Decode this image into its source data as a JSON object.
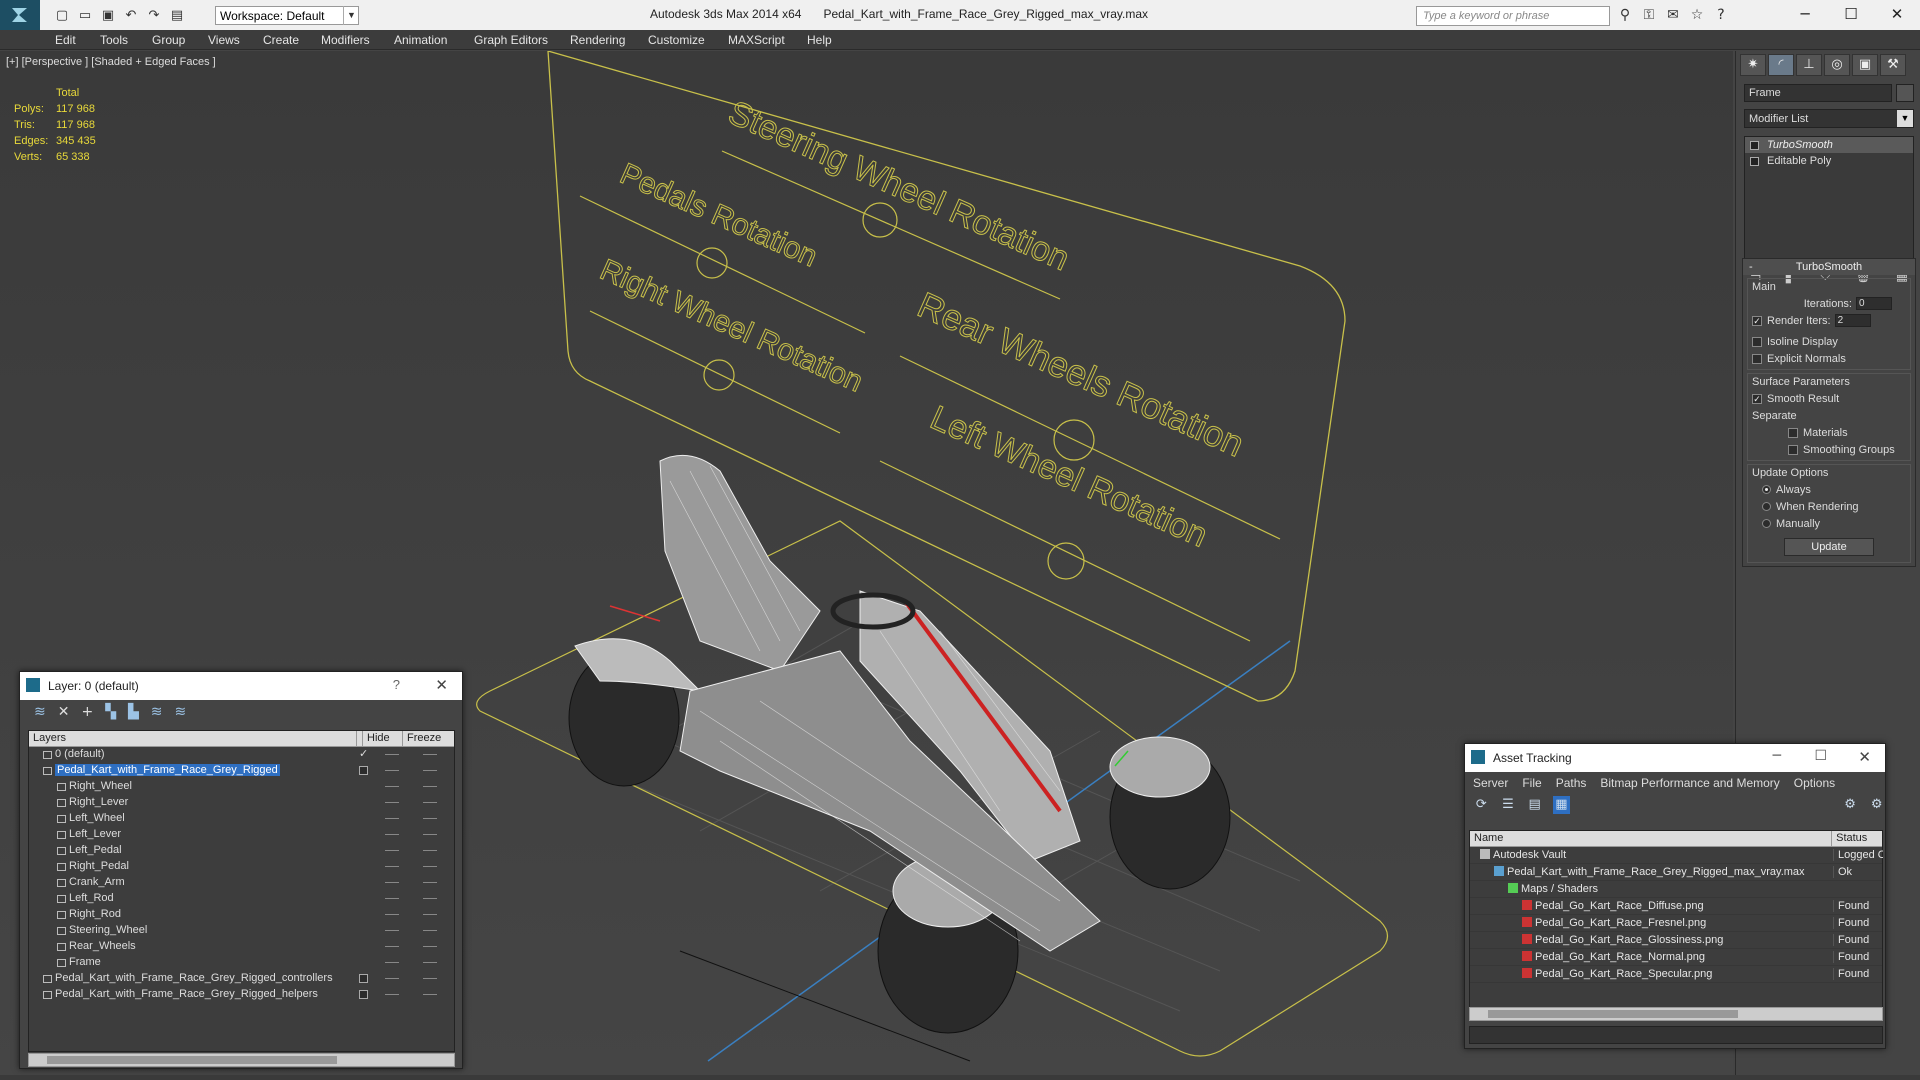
{
  "titlebar": {
    "workspace": "Workspace: Default",
    "app": "Autodesk 3ds Max  2014 x64",
    "file": "Pedal_Kart_with_Frame_Race_Grey_Rigged_max_vray.max",
    "search_placeholder": "Type a keyword or phrase"
  },
  "menu": [
    "Edit",
    "Tools",
    "Group",
    "Views",
    "Create",
    "Modifiers",
    "Animation",
    "Graph Editors",
    "Rendering",
    "Customize",
    "MAXScript",
    "Help"
  ],
  "viewport": {
    "label": "[+] [Perspective ] [Shaded + Edged Faces ]",
    "stats": {
      "header": "Total",
      "rows": [
        {
          "k": "Polys:",
          "v": "117 968"
        },
        {
          "k": "Tris:",
          "v": "117 968"
        },
        {
          "k": "Edges:",
          "v": "345 435"
        },
        {
          "k": "Verts:",
          "v": "65 338"
        }
      ]
    },
    "controls": [
      "Steering Wheel Rotation",
      "Pedals Rotation",
      "Right Wheel Rotation",
      "Rear Wheels Rotation",
      "Left Wheel Rotation"
    ]
  },
  "command_panel": {
    "object_name": "Frame",
    "modifier_list": "Modifier List",
    "stack": [
      "TurboSmooth",
      "Editable Poly"
    ],
    "rollout_title": "TurboSmooth",
    "main": {
      "title": "Main",
      "iterations_label": "Iterations:",
      "iterations_value": "0",
      "render_iters_label": "Render Iters:",
      "render_iters_value": "2",
      "isoline": "Isoline Display",
      "explicit": "Explicit Normals"
    },
    "surface": {
      "title": "Surface Parameters",
      "smooth": "Smooth Result",
      "separate": "Separate",
      "materials": "Materials",
      "smoothing": "Smoothing Groups"
    },
    "update": {
      "title": "Update Options",
      "always": "Always",
      "when": "When Rendering",
      "manually": "Manually",
      "button": "Update"
    }
  },
  "layer_dialog": {
    "title": "Layer: 0 (default)",
    "help": "?",
    "cols": [
      "Layers",
      "Hide",
      "Freeze"
    ],
    "rows": [
      {
        "name": "0 (default)",
        "indent": 0,
        "sel": false,
        "check": true,
        "box": false
      },
      {
        "name": "Pedal_Kart_with_Frame_Race_Grey_Rigged",
        "indent": 0,
        "sel": true,
        "check": false,
        "box": true
      },
      {
        "name": "Right_Wheel",
        "indent": 1
      },
      {
        "name": "Right_Lever",
        "indent": 1
      },
      {
        "name": "Left_Wheel",
        "indent": 1
      },
      {
        "name": "Left_Lever",
        "indent": 1
      },
      {
        "name": "Left_Pedal",
        "indent": 1
      },
      {
        "name": "Right_Pedal",
        "indent": 1
      },
      {
        "name": "Crank_Arm",
        "indent": 1
      },
      {
        "name": "Left_Rod",
        "indent": 1
      },
      {
        "name": "Right_Rod",
        "indent": 1
      },
      {
        "name": "Steering_Wheel",
        "indent": 1
      },
      {
        "name": "Rear_Wheels",
        "indent": 1
      },
      {
        "name": "Frame",
        "indent": 1
      },
      {
        "name": "Pedal_Kart_with_Frame_Race_Grey_Rigged_controllers",
        "indent": 0,
        "box": true
      },
      {
        "name": "Pedal_Kart_with_Frame_Race_Grey_Rigged_helpers",
        "indent": 0,
        "box": true
      }
    ]
  },
  "asset_dialog": {
    "title": "Asset Tracking",
    "menu": [
      "Server",
      "File",
      "Paths",
      "Bitmap Performance and Memory",
      "Options"
    ],
    "cols": [
      "Name",
      "Status"
    ],
    "rows": [
      {
        "name": "Autodesk Vault",
        "indent": 1,
        "status": "Logged Out",
        "icon": "vault"
      },
      {
        "name": "Pedal_Kart_with_Frame_Race_Grey_Rigged_max_vray.max",
        "indent": 2,
        "status": "Ok",
        "icon": "max"
      },
      {
        "name": "Maps / Shaders",
        "indent": 3,
        "status": "",
        "icon": "maps"
      },
      {
        "name": "Pedal_Go_Kart_Race_Diffuse.png",
        "indent": 4,
        "status": "Found",
        "icon": "png"
      },
      {
        "name": "Pedal_Go_Kart_Race_Fresnel.png",
        "indent": 4,
        "status": "Found",
        "icon": "png"
      },
      {
        "name": "Pedal_Go_Kart_Race_Glossiness.png",
        "indent": 4,
        "status": "Found",
        "icon": "png"
      },
      {
        "name": "Pedal_Go_Kart_Race_Normal.png",
        "indent": 4,
        "status": "Found",
        "icon": "png"
      },
      {
        "name": "Pedal_Go_Kart_Race_Specular.png",
        "indent": 4,
        "status": "Found",
        "icon": "png"
      }
    ]
  },
  "colors": {
    "accent": "#2e6fc2",
    "controls": "#d4cc4a",
    "stats": "#e8d93a"
  }
}
